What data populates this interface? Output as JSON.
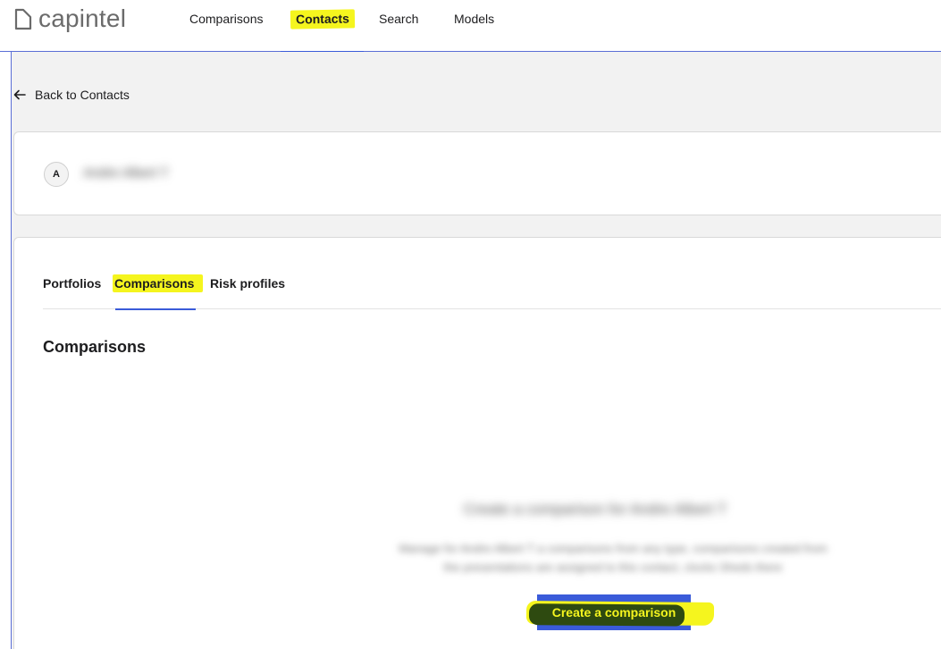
{
  "brand": {
    "name": "capintel"
  },
  "nav": {
    "items": [
      {
        "label": "Comparisons",
        "active": false
      },
      {
        "label": "Contacts",
        "active": true
      },
      {
        "label": "Search",
        "active": false
      },
      {
        "label": "Models",
        "active": false
      }
    ]
  },
  "back_link": {
    "label": "Back to Contacts"
  },
  "contact": {
    "avatar_initial": "A",
    "name": "Andre Albert T"
  },
  "tabs": {
    "items": [
      {
        "label": "Portfolios",
        "active": false
      },
      {
        "label": "Comparisons",
        "active": true
      },
      {
        "label": "Risk profiles",
        "active": false
      }
    ]
  },
  "section": {
    "title": "Comparisons"
  },
  "empty_state": {
    "title": "Create a comparison for Andre Albert T",
    "description_line1": "Manage for Andre Albert T a comparisons from any type, comparisons created from",
    "description_line2": "the presentations are assigned to this contact, clocks Sheds there",
    "button_label": "Create a comparison"
  },
  "colors": {
    "accent": "#3a5bd9",
    "highlight": "#f5f51e",
    "background": "#f2f2f2"
  }
}
